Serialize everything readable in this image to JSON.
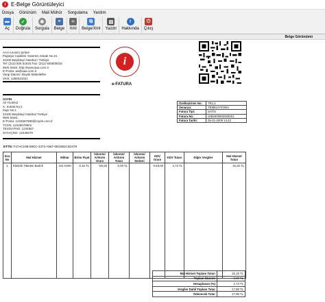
{
  "window": {
    "title": "E-Belge Görüntüleyici"
  },
  "menu": [
    "Dosya",
    "Görünüm",
    "Mali Mühür",
    "Sorgulama",
    "Yardım"
  ],
  "toolbar": [
    {
      "label": "Aç",
      "icon": "folder-icon",
      "color": "#3a7bd5"
    },
    {
      "label": "Doğrula",
      "icon": "check-icon",
      "color": "#2e9e3e"
    },
    {
      "label": "Sorgula",
      "icon": "gear-icon",
      "color": "#8a8a8a"
    },
    {
      "label": "Belge",
      "icon": "document-icon",
      "color": "#4a6fa5"
    },
    {
      "label": "Xml",
      "icon": "xml-icon",
      "color": "#6a6a6a"
    },
    {
      "label": "Belge/Xml",
      "icon": "document-xml-icon",
      "color": "#3a7bd5"
    },
    {
      "label": "Yazdır",
      "icon": "printer-icon",
      "color": "#555555"
    },
    {
      "label": "Hakkında",
      "icon": "info-icon",
      "color": "#2d6cc0"
    },
    {
      "label": "Çıkış",
      "icon": "exit-icon",
      "color": "#c0392b"
    }
  ],
  "doc_header": {
    "title": "Belge Görünümü"
  },
  "seller": {
    "name": "AAA Anonim Şirketi",
    "lines": [
      "Papatya Caddesi Yasemin Sokak  No:21",
      "34100 Beşiktaş/ İstanbul / Türkiye",
      "Tel: (212) 925 51515 Fax: (212) 925505015",
      "Web Sitesi: http://www.aaa.com.tr",
      "E-Posta: aa@aaa.com.tr",
      "Vergi Dairesi: Büyük Mükellefler",
      "VKN: 1288331521"
    ]
  },
  "buyer": {
    "header": "SAYIN",
    "lines": [
      "Ali YILMAZ",
      "X. Sokak  No:1",
      "Kapı No:1",
      "34100 Beşiktaş/ İstanbul Türkiye",
      "Web Sitesi:",
      "E-Posta: 1234567890@mydn.com.tr",
      "TCKN: 12345678901",
      "TESİSATNO: 1234567",
      "SAYAÇNO: 12345678"
    ]
  },
  "logo": {
    "letter": "i",
    "caption": "e-FATURA"
  },
  "meta": [
    {
      "k": "Özelleştirme No:",
      "v": "TR1.2"
    },
    {
      "k": "Senaryo:",
      "v": "TEMELFATURA"
    },
    {
      "k": "Fatura Tipi:",
      "v": "SATIS"
    },
    {
      "k": "Fatura No:",
      "v": "GIB2009000000001"
    },
    {
      "k": "Fatura Tarihi:",
      "v": "05-01-2009 14:42"
    }
  ],
  "ettn": {
    "label": "ETTN:",
    "value": "F47AC10B-58CC-4372-A567-0E02B2C3D479"
  },
  "items_header": [
    "Sıra No",
    "Mal Hizmet",
    "Miktar",
    "Birim Fiyat",
    "İskonto/ Arttırım Oranı",
    "İskonto/ Arttırım Tutarı",
    "İskonto/ Arttırım Nedeni",
    "KDV Oranı",
    "KDV Tutarı",
    "Diğer Vergiler",
    "Mal Hizmet Tutarı"
  ],
  "items": [
    {
      "sira": "1",
      "mal": "Elektrik Tüketim Bedeli",
      "miktar": "101 KWH",
      "birim": "0,15 TL",
      "isk_oran": "%0,00",
      "isk_tutar": "0,00 TL",
      "isk_neden": "",
      "kdv_oran": "%18,00",
      "kdv_tutar": "2,73 TL",
      "diger": "",
      "tutar": "15,15 TL"
    }
  ],
  "totals": [
    {
      "k": "Mal Hizmet Toplam Tutarı",
      "v": "15,15 TL"
    },
    {
      "k": "Toplam İskonto",
      "v": "0,00 TL"
    },
    {
      "k": "Hesaplanan (%)",
      "v": "2,73 TL"
    },
    {
      "k": "Vergiler Dahil Toplam Tutar",
      "v": "17,88 TL"
    },
    {
      "k": "Ödenecek Tutar",
      "v": "17,88 TL"
    }
  ]
}
